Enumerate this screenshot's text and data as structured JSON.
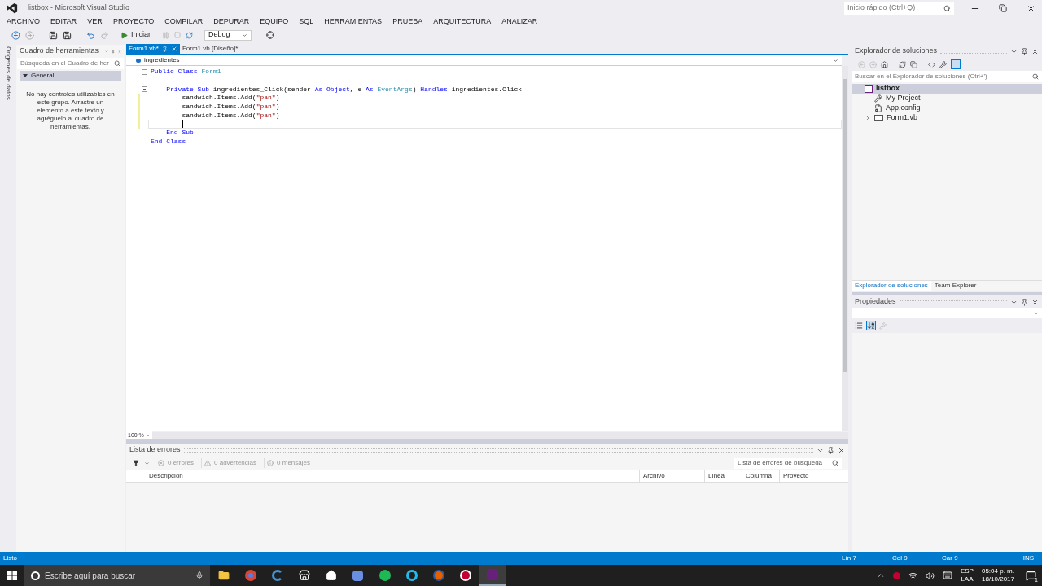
{
  "window": {
    "title": "listbox - Microsoft Visual Studio",
    "quick_launch_placeholder": "Inicio rápido (Ctrl+Q)"
  },
  "menu": [
    "ARCHIVO",
    "EDITAR",
    "VER",
    "PROYECTO",
    "COMPILAR",
    "DEPURAR",
    "EQUIPO",
    "SQL",
    "HERRAMIENTAS",
    "PRUEBA",
    "ARQUITECTURA",
    "ANALIZAR"
  ],
  "toolbar": {
    "start_label": "Iniciar",
    "configuration": "Debug"
  },
  "side_tab": "Orígenes de datos",
  "toolbox": {
    "title": "Cuadro de herramientas",
    "search_placeholder": "Búsqueda en el Cuadro de her",
    "group": {
      "label": "General",
      "expanded": true
    },
    "empty_message": "No hay controles utilizables en este grupo. Arrastre un elemento a este texto y agréguelo al cuadro de herramientas."
  },
  "editor_tabs": [
    {
      "label": "Form1.vb*",
      "selected": true
    },
    {
      "label": "Form1.vb [Diseño]*",
      "selected": false
    }
  ],
  "editor": {
    "member_dropdown": "ingredientes",
    "zoom": "100 %",
    "lines": [
      {
        "fold": true,
        "modified": false,
        "current": false,
        "tokens": [
          {
            "kind": "keyword",
            "text": "Public Class "
          },
          {
            "kind": "type",
            "text": "Form1"
          }
        ]
      },
      {
        "fold": false,
        "modified": false,
        "current": false
      },
      {
        "fold": true,
        "modified": false,
        "current": false,
        "tokens": [
          {
            "kind": "keyword",
            "text": "    Private Sub "
          },
          {
            "kind": "plain",
            "text": "ingredientes_Click(sender "
          },
          {
            "kind": "keyword",
            "text": "As Object"
          },
          {
            "kind": "plain",
            "text": ", e "
          },
          {
            "kind": "keyword",
            "text": "As "
          },
          {
            "kind": "type",
            "text": "EventArgs"
          },
          {
            "kind": "plain",
            "text": ") "
          },
          {
            "kind": "keyword",
            "text": "Handles "
          },
          {
            "kind": "plain",
            "text": "ingredientes.Click"
          }
        ]
      },
      {
        "fold": false,
        "modified": true,
        "current": false,
        "tokens": [
          {
            "kind": "plain",
            "text": "        sandwich.Items.Add("
          },
          {
            "kind": "string",
            "text": "\"pan\""
          },
          {
            "kind": "plain",
            "text": ")"
          }
        ]
      },
      {
        "fold": false,
        "modified": true,
        "current": false,
        "tokens": [
          {
            "kind": "plain",
            "text": "        sandwich.Items.Add("
          },
          {
            "kind": "string",
            "text": "\"pan\""
          },
          {
            "kind": "plain",
            "text": ")"
          }
        ]
      },
      {
        "fold": false,
        "modified": true,
        "current": false,
        "tokens": [
          {
            "kind": "plain",
            "text": "        sandwich.Items.Add("
          },
          {
            "kind": "string",
            "text": "\"pan\""
          },
          {
            "kind": "plain",
            "text": ")"
          }
        ]
      },
      {
        "fold": false,
        "modified": true,
        "current": true
      },
      {
        "fold": false,
        "modified": false,
        "current": false,
        "tokens": [
          {
            "kind": "keyword",
            "text": "    End Sub"
          }
        ]
      },
      {
        "fold": false,
        "modified": false,
        "current": false,
        "tokens": [
          {
            "kind": "keyword",
            "text": "End Class"
          }
        ]
      }
    ]
  },
  "error_list": {
    "title": "Lista de errores",
    "filters": [
      "0 errores",
      "0 advertencias",
      "0 mensajes"
    ],
    "search_placeholder": "Lista de errores de búsqueda",
    "columns": [
      "Descripción",
      "Archivo",
      "Línea",
      "Columna",
      "Proyecto"
    ]
  },
  "solution_explorer": {
    "title": "Explorador de soluciones",
    "search_placeholder": "Buscar en el Explorador de soluciones (Ctrl+')",
    "tree": [
      {
        "label": "listbox",
        "kind": "project",
        "selected": true,
        "expanded": true,
        "children": [
          {
            "label": "My Project",
            "kind": "settings",
            "selected": false
          },
          {
            "label": "App.config",
            "kind": "config",
            "selected": false
          },
          {
            "label": "Form1.vb",
            "kind": "form",
            "selected": false,
            "expanded": false
          }
        ]
      }
    ],
    "tabs": [
      {
        "label": "Explorador de soluciones",
        "selected": true
      },
      {
        "label": "Team Explorer",
        "selected": false
      }
    ]
  },
  "properties": {
    "title": "Propiedades"
  },
  "status_bar": {
    "text": "Listo",
    "line": "Lín 7",
    "col": "Col 9",
    "char": "Car 9",
    "mode": "INS"
  },
  "taskbar": {
    "search_placeholder": "Escribe aquí para buscar",
    "language": "ESP",
    "layout": "LAA",
    "time": "05:04 p. m.",
    "date": "18/10/2017",
    "notifications": "1"
  }
}
